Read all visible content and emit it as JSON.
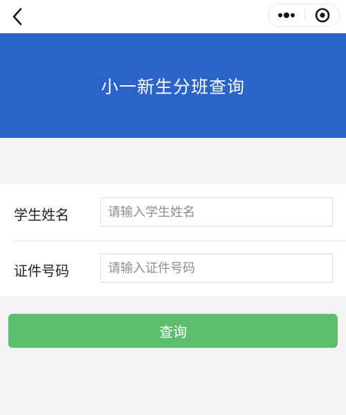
{
  "nav": {
    "back_icon": "chevron-left-icon",
    "more_icon": "more-dots-icon",
    "close_icon": "target-circle-icon"
  },
  "banner": {
    "title": "小一新生分班查询",
    "background": "#2b63c8"
  },
  "form": {
    "student_name": {
      "label": "学生姓名",
      "placeholder": "请输入学生姓名",
      "value": ""
    },
    "id_number": {
      "label": "证件号码",
      "placeholder": "请输入证件号码",
      "value": ""
    }
  },
  "actions": {
    "query_label": "查询",
    "query_color": "#5ebe6e"
  }
}
